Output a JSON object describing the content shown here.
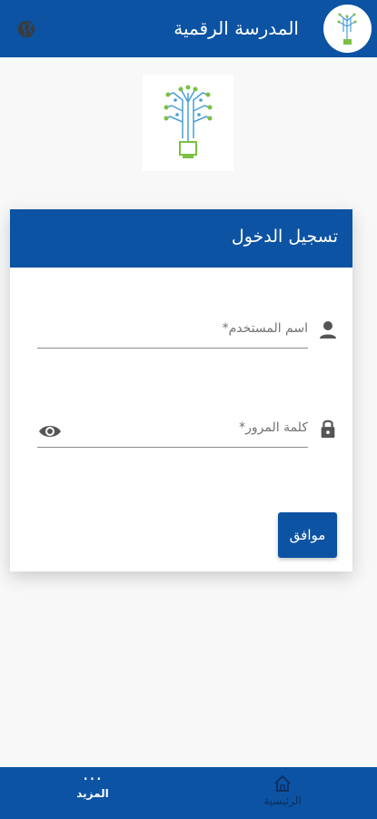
{
  "header": {
    "app_title": "المدرسة الرقمية",
    "language_icon": "globe-icon",
    "logo_icon": "tree-logo-icon"
  },
  "login": {
    "title": "تسجيل الدخول",
    "username_placeholder": "اسم المستخدم*",
    "password_placeholder": "كلمة المرور*",
    "submit_label": "موافق"
  },
  "bottom_nav": {
    "items": [
      {
        "label": "الرئيسية",
        "icon": "home-icon"
      },
      {
        "label": "المزيد",
        "icon": "more-dots-icon"
      }
    ]
  },
  "colors": {
    "primary": "#0c53a3",
    "background": "#f8f8f8"
  }
}
